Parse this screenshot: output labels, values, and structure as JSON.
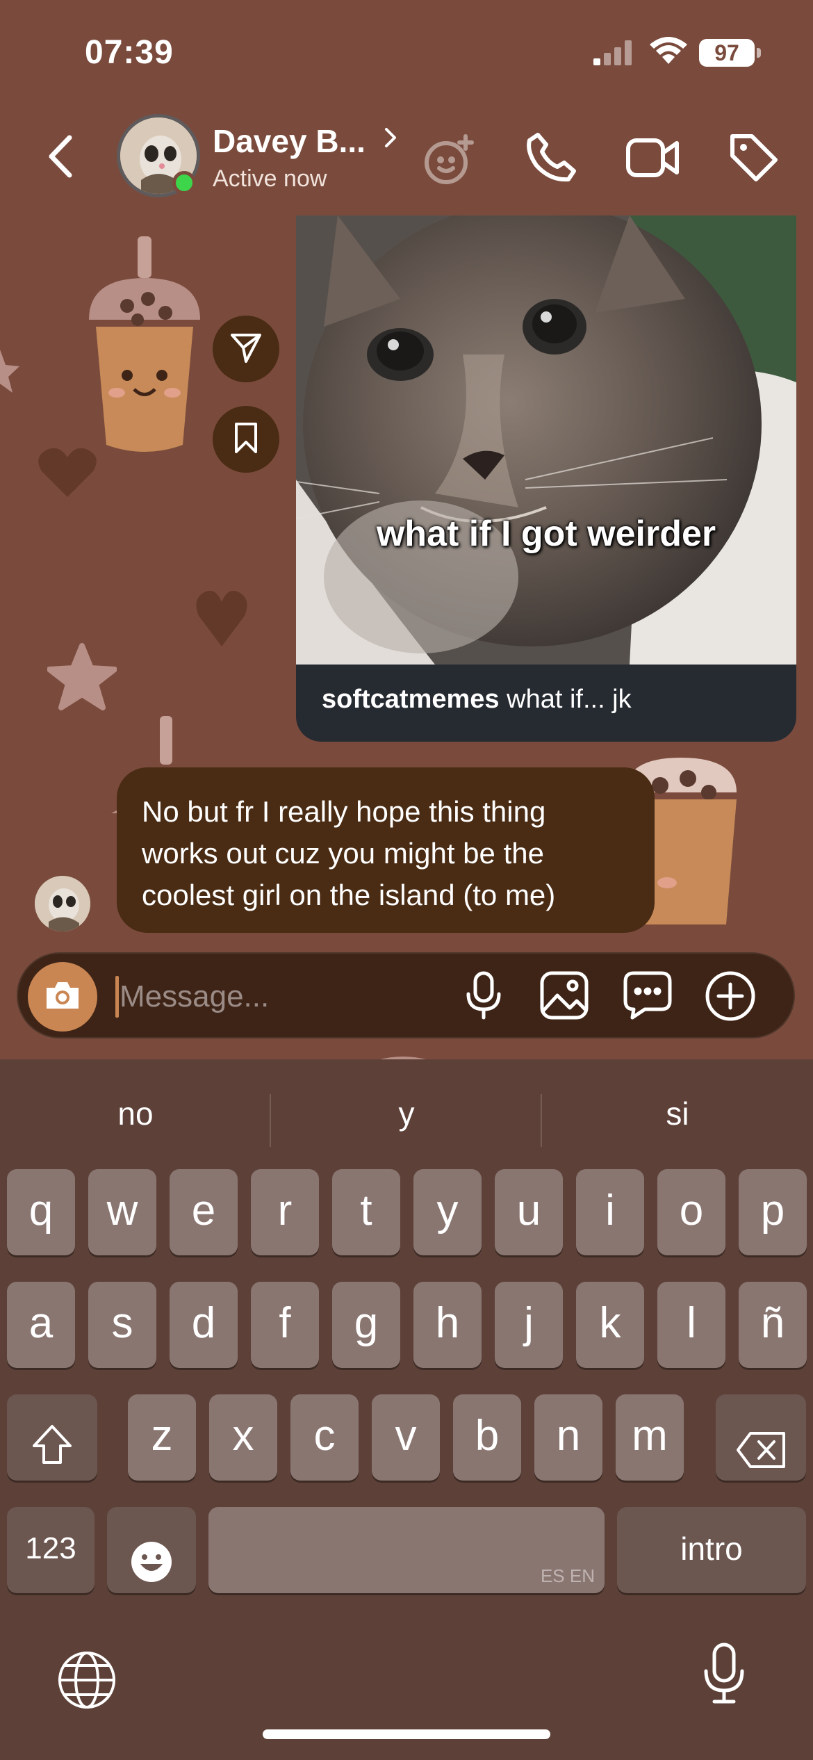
{
  "status_bar": {
    "time": "07:39",
    "battery": "97"
  },
  "header": {
    "contact_name": "Davey B...",
    "contact_status": "Active now",
    "icons": [
      "back-icon",
      "chevron-right-icon",
      "add-effect-icon",
      "phone-icon",
      "video-icon",
      "tag-icon"
    ]
  },
  "shared_post": {
    "overlay_text": "what if I got weirder",
    "author": "softcatmemes",
    "caption": "what if... jk"
  },
  "message": {
    "lines": [
      "No but fr I really hope this thing",
      "works out cuz you might be the",
      "coolest girl on the island (to me)"
    ]
  },
  "composer": {
    "placeholder": "Message..."
  },
  "keyboard": {
    "suggestions": [
      "no",
      "y",
      "si"
    ],
    "row1": [
      "q",
      "w",
      "e",
      "r",
      "t",
      "y",
      "u",
      "i",
      "o",
      "p"
    ],
    "row2": [
      "a",
      "s",
      "d",
      "f",
      "g",
      "h",
      "j",
      "k",
      "l",
      "ñ"
    ],
    "row3": [
      "z",
      "x",
      "c",
      "v",
      "b",
      "n",
      "m"
    ],
    "numbers_key": "123",
    "space_languages": "ES EN",
    "return_key": "intro"
  },
  "colors": {
    "wallpaper": "#7a4b3c",
    "bubble": "#4a2b13",
    "accent": "#c98552",
    "keyboard_bg": "#5d4138",
    "key": "#8a7671",
    "online": "#3dd64b"
  }
}
